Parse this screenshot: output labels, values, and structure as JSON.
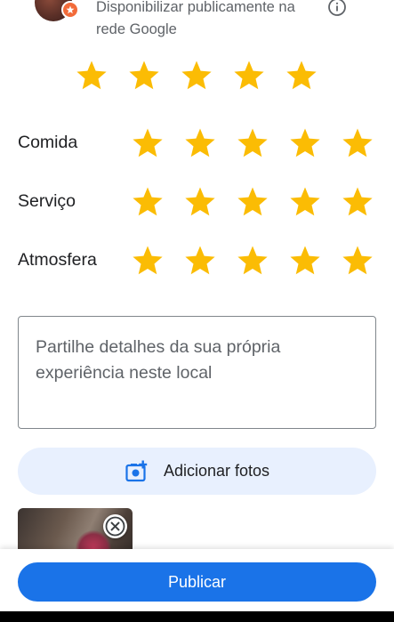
{
  "header": {
    "visibility_text": "Disponibilizar publicamente na rede Google",
    "info_icon": "info-icon",
    "avatar_badge_color": "#f26b3a"
  },
  "colors": {
    "star": "#fbbc04",
    "primary": "#1a73e8",
    "add_photos_bg": "#e8f0fe"
  },
  "overall_rating": {
    "value": 5,
    "max": 5
  },
  "categories": [
    {
      "label": "Comida",
      "rating": 5
    },
    {
      "label": "Serviço",
      "rating": 5
    },
    {
      "label": "Atmosfera",
      "rating": 5
    }
  ],
  "review": {
    "placeholder": "Partilhe detalhes da sua própria experiência neste local",
    "value": ""
  },
  "add_photos": {
    "label": "Adicionar fotos",
    "icon": "add-photo-icon"
  },
  "photos": [
    {
      "icon_remove": "close-icon"
    }
  ],
  "footer": {
    "publish_label": "Publicar"
  }
}
